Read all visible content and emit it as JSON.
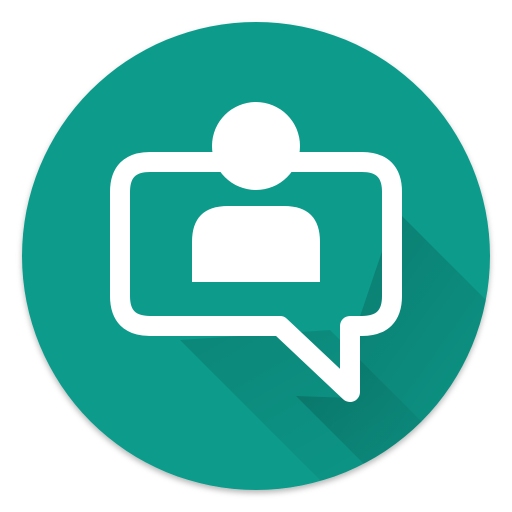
{
  "icon": {
    "name": "contact-chat-app-icon",
    "background_color": "#109b8b",
    "glyph_color": "#ffffff",
    "shadow_color": "#0c7d70"
  }
}
